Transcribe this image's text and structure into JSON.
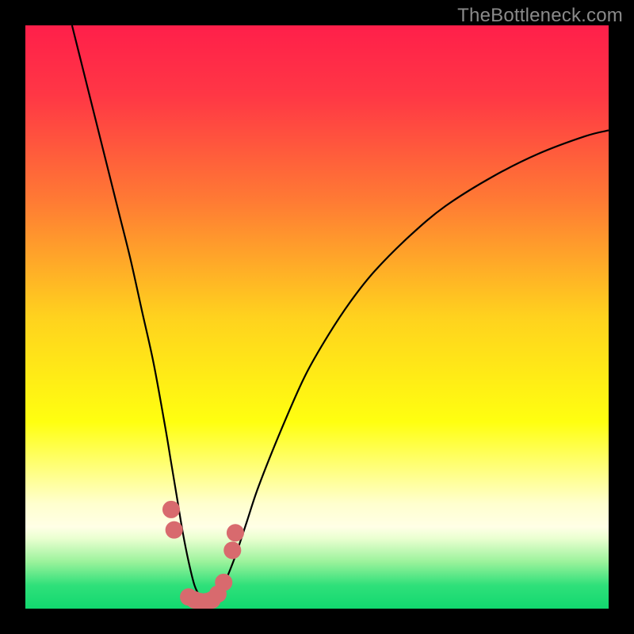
{
  "watermark": "TheBottleneck.com",
  "colors": {
    "frame": "#000000",
    "curve": "#000000",
    "marker_fill": "#d86a6e",
    "marker_stroke": "#d86a6e",
    "green_band": "#2fe07a"
  },
  "chart_data": {
    "type": "line",
    "title": "",
    "xlabel": "",
    "ylabel": "",
    "xlim": [
      0,
      100
    ],
    "ylim": [
      0,
      100
    ],
    "gradient_stops": [
      {
        "offset": 0.0,
        "color": "#ff1f4a"
      },
      {
        "offset": 0.12,
        "color": "#ff3745"
      },
      {
        "offset": 0.3,
        "color": "#ff7a34"
      },
      {
        "offset": 0.5,
        "color": "#ffd21e"
      },
      {
        "offset": 0.68,
        "color": "#ffff10"
      },
      {
        "offset": 0.82,
        "color": "#ffffce"
      },
      {
        "offset": 0.86,
        "color": "#ffffe6"
      },
      {
        "offset": 0.88,
        "color": "#e9ffd0"
      },
      {
        "offset": 0.92,
        "color": "#9af29b"
      },
      {
        "offset": 0.96,
        "color": "#2fe07a"
      },
      {
        "offset": 1.0,
        "color": "#12d86f"
      }
    ],
    "series": [
      {
        "name": "bottleneck-curve",
        "x": [
          8,
          10,
          12,
          14,
          16,
          18,
          20,
          22,
          24,
          25,
          26,
          27,
          28,
          29,
          30,
          31,
          32,
          33,
          34,
          36,
          38,
          40,
          44,
          48,
          52,
          56,
          60,
          66,
          72,
          80,
          88,
          96,
          100
        ],
        "y": [
          100,
          92,
          84,
          76,
          68,
          60,
          51,
          42,
          31,
          25,
          19,
          13,
          8,
          4,
          2,
          1,
          1,
          2,
          4,
          9,
          15,
          21,
          31,
          40,
          47,
          53,
          58,
          64,
          69,
          74,
          78,
          81,
          82
        ]
      }
    ],
    "markers": [
      {
        "x": 25.0,
        "y": 17.0
      },
      {
        "x": 25.5,
        "y": 13.5
      },
      {
        "x": 28.0,
        "y": 2.0
      },
      {
        "x": 29.0,
        "y": 1.5
      },
      {
        "x": 30.0,
        "y": 1.2
      },
      {
        "x": 31.0,
        "y": 1.2
      },
      {
        "x": 32.0,
        "y": 1.5
      },
      {
        "x": 33.0,
        "y": 2.5
      },
      {
        "x": 34.0,
        "y": 4.5
      },
      {
        "x": 35.5,
        "y": 10.0
      },
      {
        "x": 36.0,
        "y": 13.0
      }
    ],
    "marker_radius_pct": 1.5
  }
}
